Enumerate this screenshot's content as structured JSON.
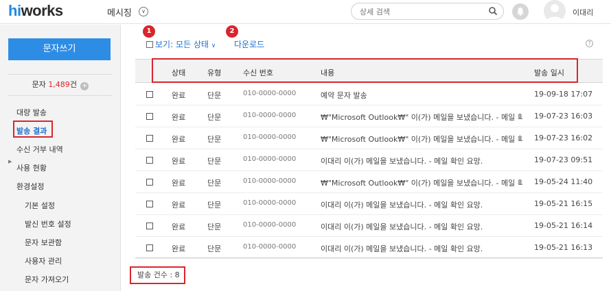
{
  "header": {
    "logo_main": "works",
    "logo_accent": "hi",
    "app_name": "메시징",
    "search_placeholder": "상세 검색",
    "user_name": "이대리"
  },
  "sidebar": {
    "compose_label": "문자쓰기",
    "credit_label": "문자",
    "credit_value": "1,489",
    "credit_unit": "건",
    "items": [
      {
        "label": "대량 발송"
      },
      {
        "label": "발송 결과"
      },
      {
        "label": "수신 거부 내역"
      },
      {
        "label": "사용 현황"
      },
      {
        "label": "환경설정"
      },
      {
        "label": "기본 설정"
      },
      {
        "label": "발신 번호 설정"
      },
      {
        "label": "문자 보관함"
      },
      {
        "label": "사용자 관리"
      },
      {
        "label": "문자 가져오기"
      }
    ]
  },
  "toolbar": {
    "view_label": "보기: 모든 상태",
    "download_label": "다운로드",
    "help": "?"
  },
  "markers": [
    "1",
    "2"
  ],
  "table": {
    "columns": [
      "상태",
      "유형",
      "수신 번호",
      "내용",
      "발송 일시"
    ],
    "rows": [
      {
        "status": "완료",
        "type": "단문",
        "phone": "010-0000-0000",
        "content": "예약 문자 발송",
        "date": "19-09-18 17:07"
      },
      {
        "status": "완료",
        "type": "단문",
        "phone": "010-0000-0000",
        "content": "₩\"Microsoft Outlook₩\" 이(가) 메일을 보냈습니다. - 메일 확인",
        "date": "19-07-23 16:03"
      },
      {
        "status": "완료",
        "type": "단문",
        "phone": "010-0000-0000",
        "content": "₩\"Microsoft Outlook₩\" 이(가) 메일을 보냈습니다. - 메일 확인",
        "date": "19-07-23 16:02"
      },
      {
        "status": "완료",
        "type": "단문",
        "phone": "010-0000-0000",
        "content": "이대리 이(가) 메일을 보냈습니다. - 메일 확인 요망.",
        "date": "19-07-23 09:51"
      },
      {
        "status": "완료",
        "type": "단문",
        "phone": "010-0000-0000",
        "content": "₩\"Microsoft Outlook₩\" 이(가) 메일을 보냈습니다. - 메일 확인",
        "date": "19-05-24 11:40"
      },
      {
        "status": "완료",
        "type": "단문",
        "phone": "010-0000-0000",
        "content": "이대리 이(가) 메일을 보냈습니다. - 메일 확인 요망.",
        "date": "19-05-21 16:15"
      },
      {
        "status": "완료",
        "type": "단문",
        "phone": "010-0000-0000",
        "content": "이대리 이(가) 메일을 보냈습니다. - 메일 확인 요망.",
        "date": "19-05-21 16:14"
      },
      {
        "status": "완료",
        "type": "단문",
        "phone": "010-0000-0000",
        "content": "이대리 이(가) 메일을 보냈습니다. - 메일 확인 요망.",
        "date": "19-05-21 16:13"
      }
    ]
  },
  "footer": {
    "count_label": "발송 건수 : 8"
  },
  "colors": {
    "accent": "#2d8de5",
    "link": "#1e6fd0",
    "highlight": "#d9252c"
  }
}
